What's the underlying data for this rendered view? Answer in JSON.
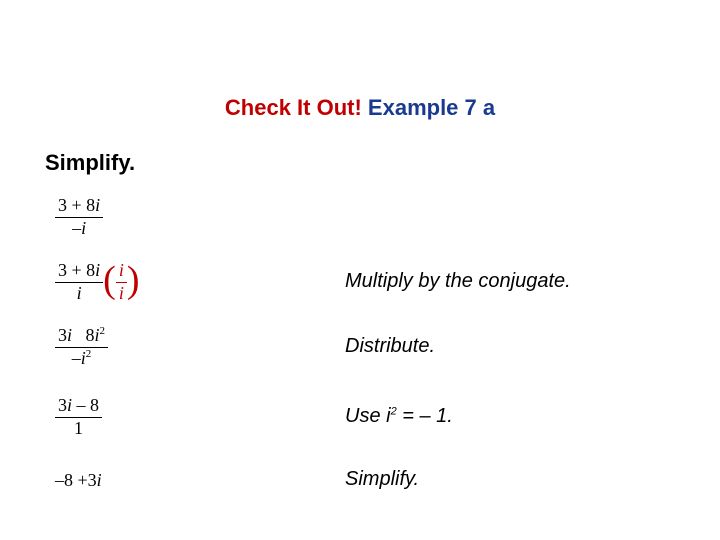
{
  "title": {
    "red_part": "Check It Out!",
    "blue_part": "Example 7 a"
  },
  "heading": "Simplify.",
  "steps": {
    "s1": {
      "num": "3 + 8",
      "i1": "i",
      "den_neg": "–",
      "den_i": "i"
    },
    "s2": {
      "num": "3 + 8",
      "i1": "i",
      "den_i": "i",
      "conj_num": "i",
      "conj_den": "i",
      "desc": "Multiply by the conjugate."
    },
    "s3": {
      "num_a": "3",
      "num_i": "i",
      "num_b": "   8",
      "num_i2": "i",
      "num_sq": "2",
      "den_neg": "–",
      "den_i": "i",
      "den_sq": "2",
      "desc": "Distribute."
    },
    "s4": {
      "num_a": "3",
      "num_i": "i",
      "num_minus": " – 8",
      "den": "1",
      "desc_a": "Use ",
      "desc_i": "i",
      "desc_sq": "2",
      "desc_b": " = – 1."
    },
    "s5": {
      "expr_a": "–8 +3",
      "expr_i": "i",
      "desc": "Simplify."
    }
  }
}
